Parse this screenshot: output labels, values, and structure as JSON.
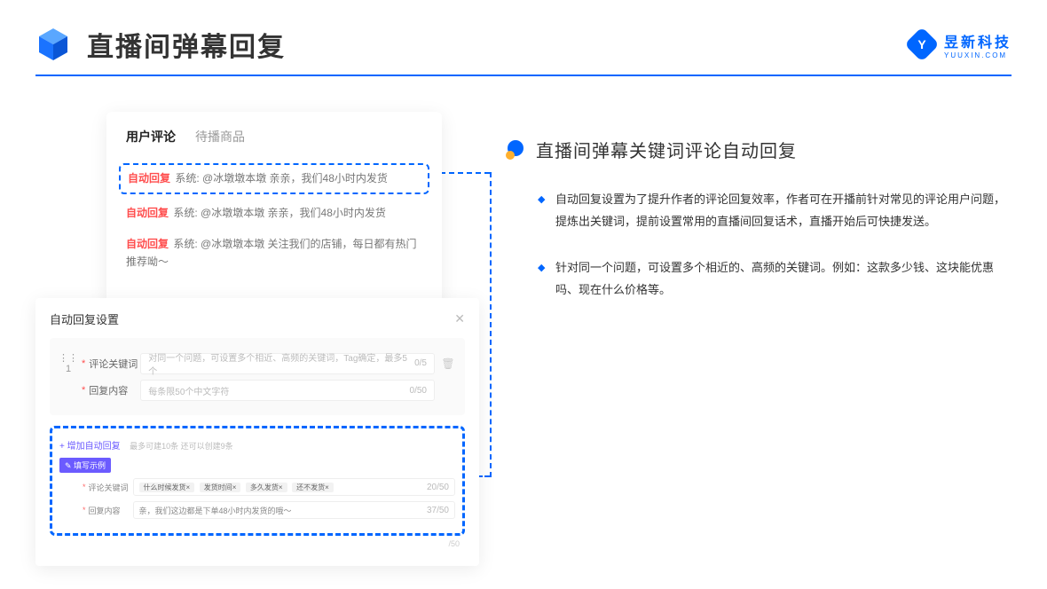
{
  "header": {
    "title": "直播间弹幕回复",
    "brand_main": "昱新科技",
    "brand_sub": "YUUXIN.COM"
  },
  "comment_panel": {
    "tab_active": "用户评论",
    "tab_inactive": "待播商品",
    "rows": [
      {
        "tag": "自动回复",
        "text": "系统: @冰墩墩本墩 亲亲，我们48小时内发货",
        "highlight": true
      },
      {
        "tag": "自动回复",
        "text": "系统: @冰墩墩本墩 亲亲，我们48小时内发货",
        "highlight": false
      },
      {
        "tag": "自动回复",
        "text": "系统: @冰墩墩本墩 关注我们的店铺，每日都有热门推荐呦～",
        "highlight": false
      }
    ]
  },
  "settings_panel": {
    "title": "自动回复设置",
    "row_index": "1",
    "keyword_label": "评论关键词",
    "keyword_placeholder": "对同一个问题，可设置多个相近、高频的关键词，Tag确定，最多5个",
    "keyword_counter": "0/5",
    "content_label": "回复内容",
    "content_placeholder": "每条限50个中文字符",
    "content_counter": "0/50",
    "add_link": "+ 增加自动回复",
    "add_note": "最多可建10条 还可以创建9条",
    "example_badge": "✎ 填写示例",
    "example": {
      "keyword_label": "评论关键词",
      "tags": [
        "什么时候发货×",
        "发货时间×",
        "多久发货×",
        "还不发货×"
      ],
      "keyword_counter": "20/50",
      "content_label": "回复内容",
      "content_text": "亲，我们这边都是下单48小时内发货的哦～",
      "content_counter": "37/50"
    },
    "outer_counter": "/50"
  },
  "right": {
    "section_title": "直播间弹幕关键词评论自动回复",
    "bullets": [
      "自动回复设置为了提升作者的评论回复效率，作者可在开播前针对常见的评论用户问题，提炼出关键词，提前设置常用的直播间回复话术，直播开始后可快捷发送。",
      "针对同一个问题，可设置多个相近的、高频的关键词。例如：这款多少钱、这块能优惠吗、现在什么价格等。"
    ]
  }
}
